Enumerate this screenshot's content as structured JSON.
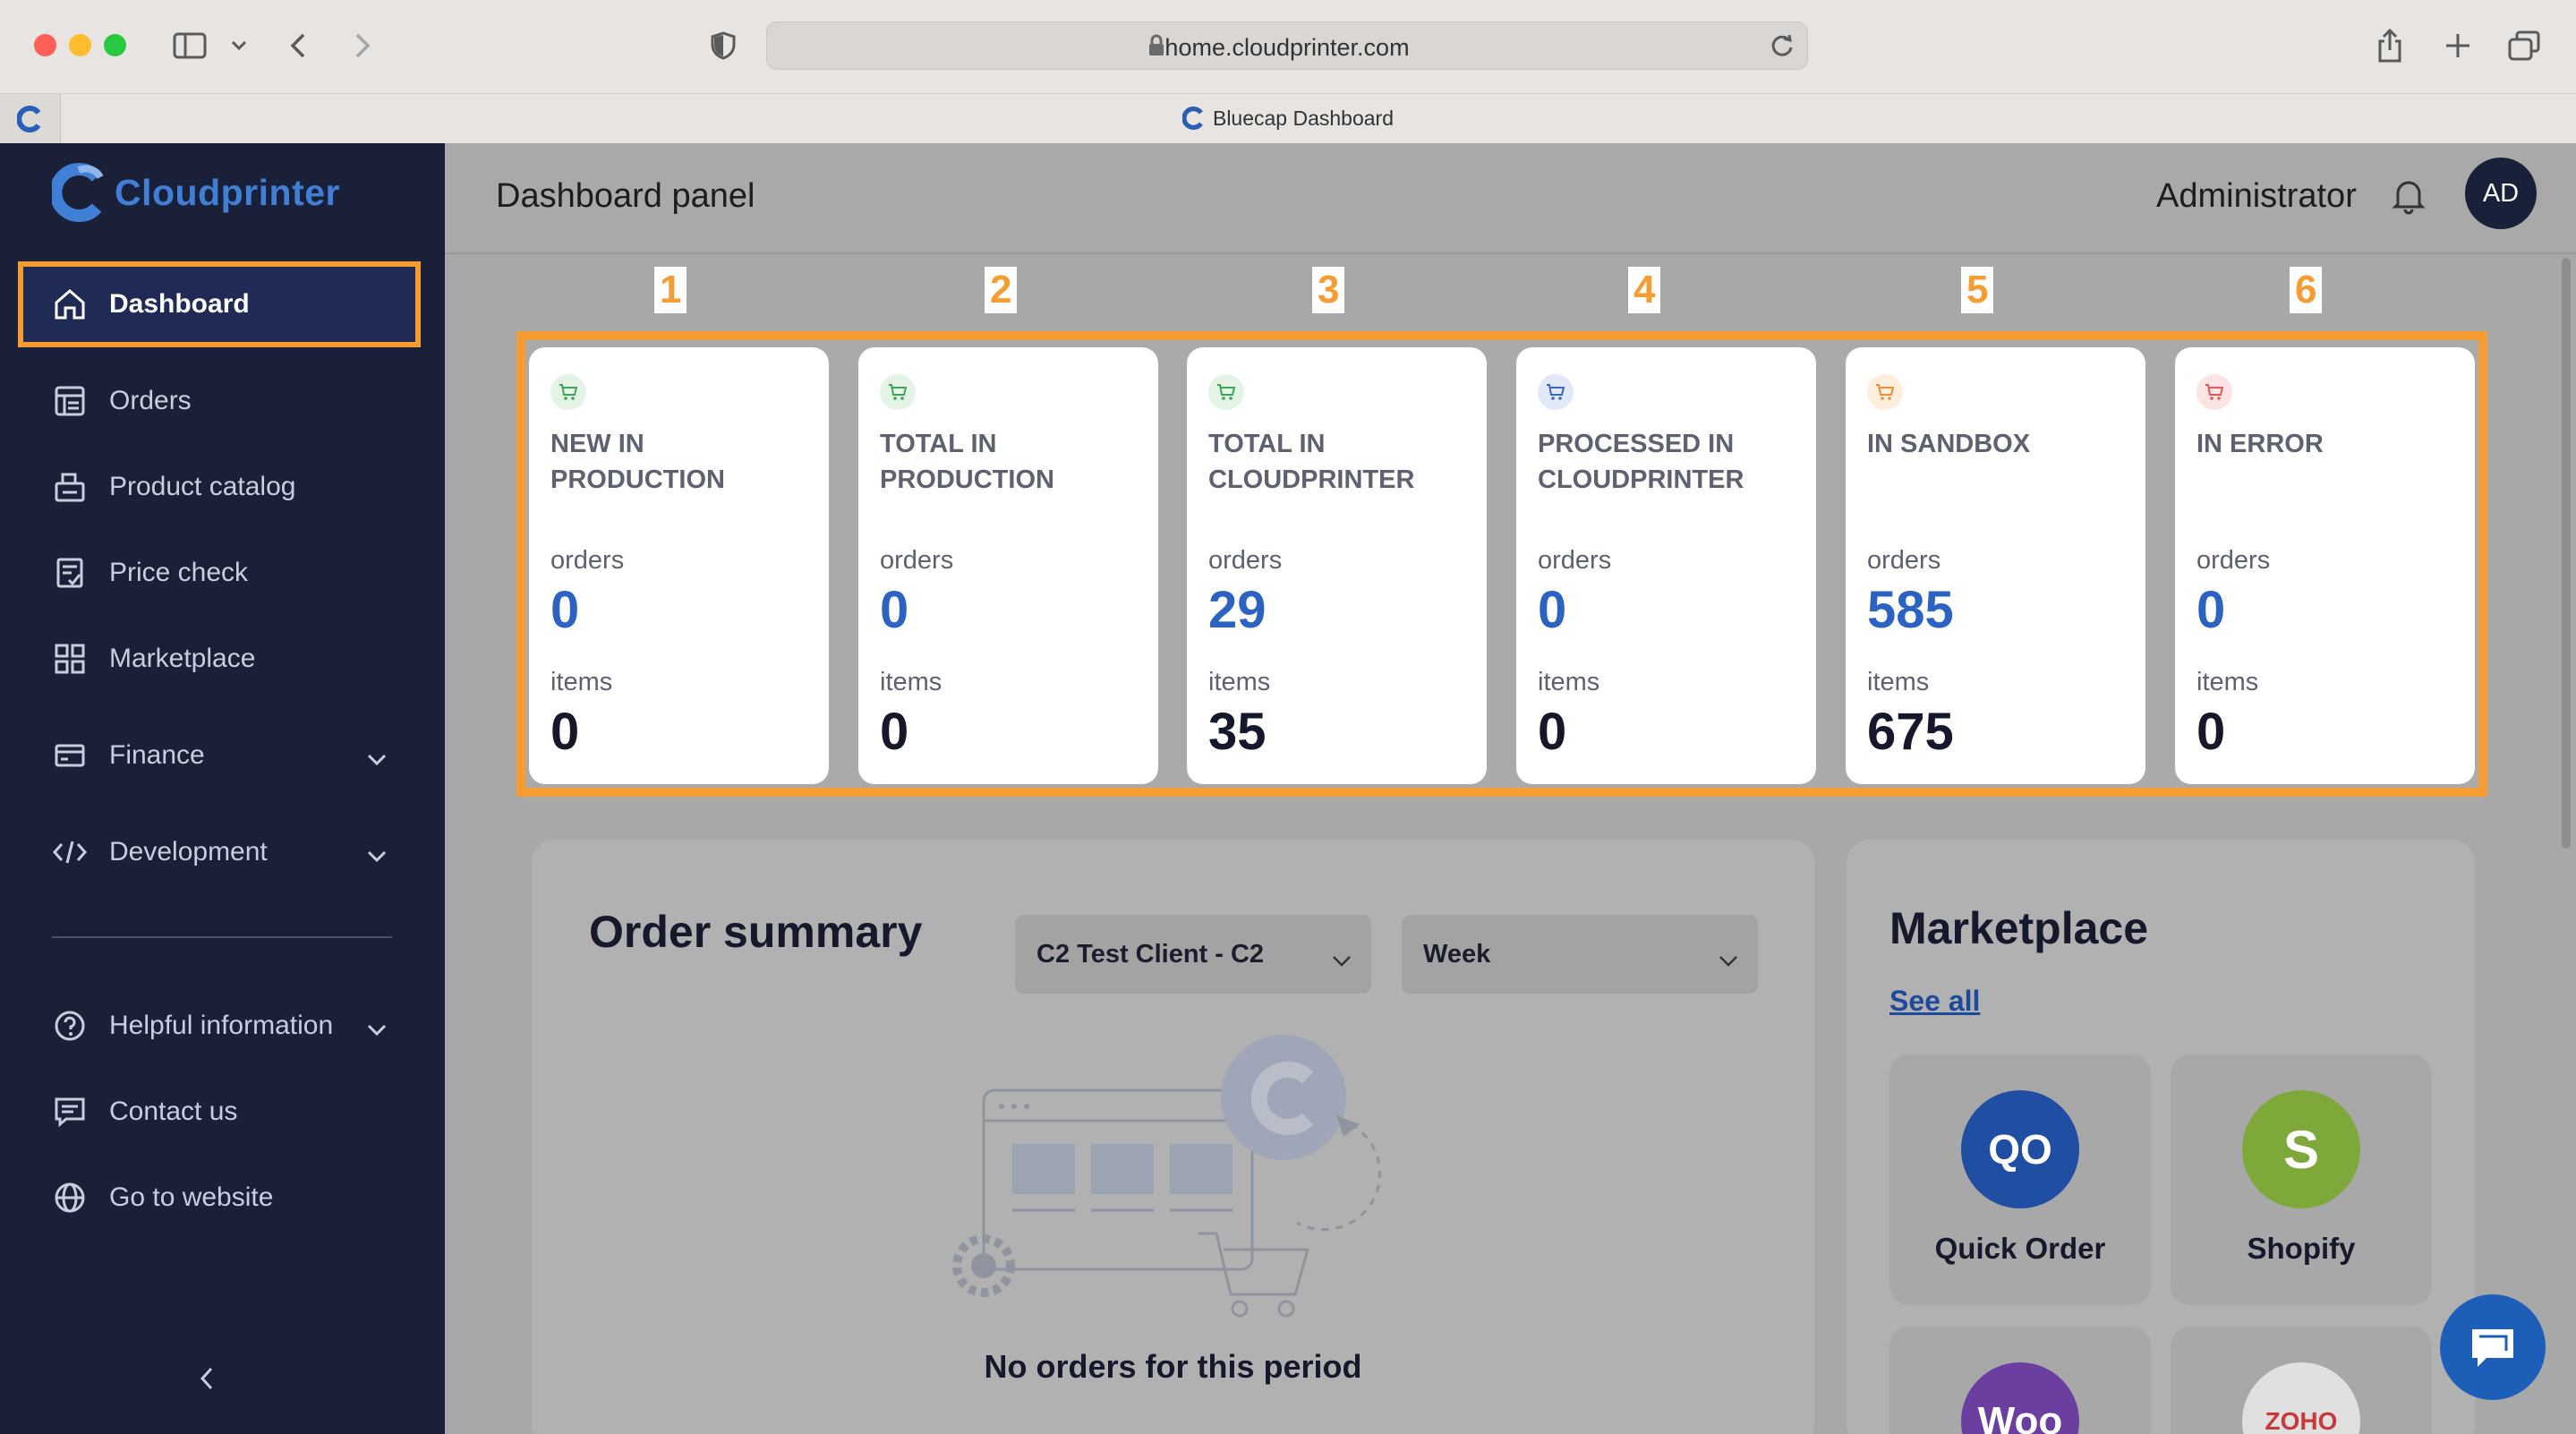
{
  "browser": {
    "url": "home.cloudprinter.com",
    "tab_title": "Bluecap Dashboard"
  },
  "sidebar": {
    "brand": "Cloudprinter",
    "items": [
      {
        "label": "Dashboard",
        "icon": "home-icon",
        "active": true
      },
      {
        "label": "Orders",
        "icon": "orders-icon"
      },
      {
        "label": "Product catalog",
        "icon": "catalog-icon"
      },
      {
        "label": "Price check",
        "icon": "price-check-icon"
      },
      {
        "label": "Marketplace",
        "icon": "marketplace-icon"
      },
      {
        "label": "Finance",
        "icon": "finance-icon",
        "expandable": true
      },
      {
        "label": "Development",
        "icon": "code-icon",
        "expandable": true
      },
      {
        "label": "Helpful information",
        "icon": "help-icon",
        "expandable": true
      },
      {
        "label": "Contact us",
        "icon": "chat-icon"
      },
      {
        "label": "Go to website",
        "icon": "globe-icon"
      }
    ]
  },
  "header": {
    "title": "Dashboard panel",
    "user_name": "Administrator",
    "avatar_initials": "AD"
  },
  "steps": [
    "1",
    "2",
    "3",
    "4",
    "5",
    "6"
  ],
  "stats": [
    {
      "title": "New in production",
      "orders_label": "orders",
      "orders": "0",
      "items_label": "items",
      "items": "0",
      "icon_color": "#3fa35b",
      "icon_bg": "#e3f4e6"
    },
    {
      "title": "Total in production",
      "orders_label": "orders",
      "orders": "0",
      "items_label": "items",
      "items": "0",
      "icon_color": "#3fa35b",
      "icon_bg": "#e3f4e6"
    },
    {
      "title": "Total in Cloudprinter",
      "orders_label": "orders",
      "orders": "29",
      "items_label": "items",
      "items": "35",
      "icon_color": "#3fa35b",
      "icon_bg": "#e3f4e6"
    },
    {
      "title": "Processed in Cloudprinter",
      "orders_label": "orders",
      "orders": "0",
      "items_label": "items",
      "items": "0",
      "icon_color": "#3a66c4",
      "icon_bg": "#e1e9f8"
    },
    {
      "title": "In sandbox",
      "orders_label": "orders",
      "orders": "585",
      "items_label": "items",
      "items": "675",
      "icon_color": "#f08c3a",
      "icon_bg": "#fdeedd"
    },
    {
      "title": "In error",
      "orders_label": "orders",
      "orders": "0",
      "items_label": "items",
      "items": "0",
      "icon_color": "#e05a5a",
      "icon_bg": "#fde4e4"
    }
  ],
  "order_summary": {
    "title": "Order summary",
    "client_select": "C2 Test Client - C2",
    "period_select": "Week",
    "empty_text": "No orders for this period"
  },
  "marketplace": {
    "title": "Marketplace",
    "see_all": "See all",
    "tiles": [
      {
        "name": "Quick Order",
        "logo_text": "QO",
        "color": "#1f4ea3"
      },
      {
        "name": "Shopify",
        "logo_text": "S",
        "color": "#7ea93a"
      },
      {
        "name": "",
        "logo_text": "Woo",
        "color": "#6b3fa0"
      },
      {
        "name": "",
        "logo_text": "ZOHO",
        "color": "#e6e6e6"
      }
    ]
  },
  "colors": {
    "accent_highlight": "#f59d33",
    "sidebar_bg": "#1a2038",
    "brand_blue": "#2c63c2"
  }
}
